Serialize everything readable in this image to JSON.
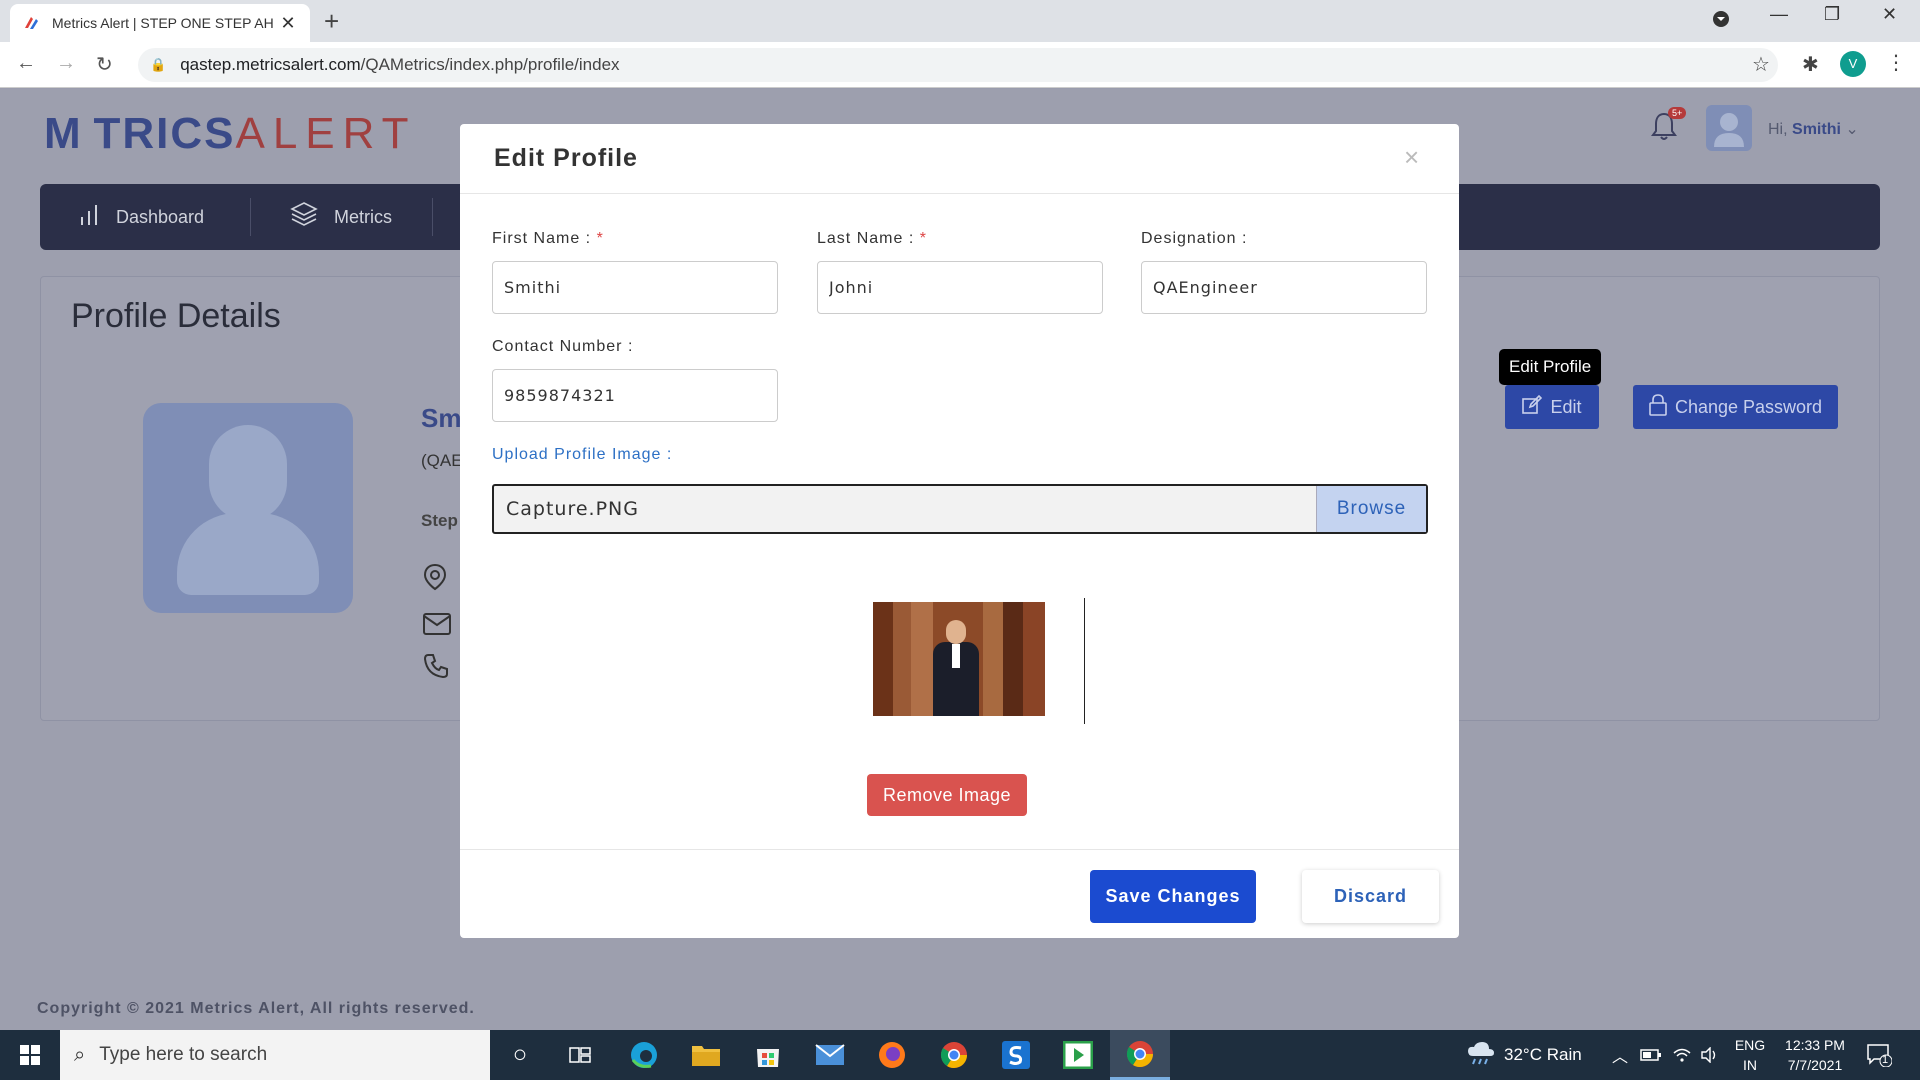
{
  "browser": {
    "tab_title": "Metrics Alert | STEP ONE STEP AH",
    "url_domain": "qastep.metricsalert.com",
    "url_path": "/QAMetrics/index.php/profile/index",
    "profile_initial": "V"
  },
  "header": {
    "logo_metrics": "M TRICS",
    "logo_alert": "ALERT",
    "notif_badge": "5+",
    "greeting": "Hi,",
    "username": "Smithi"
  },
  "nav": {
    "items": [
      {
        "label": "Dashboard"
      },
      {
        "label": "Metrics"
      }
    ]
  },
  "profile": {
    "title": "Profile Details",
    "name_partial": "Sm",
    "role_partial": "(QAE",
    "company_partial": "Step",
    "tooltip": "Edit Profile",
    "edit_label": "Edit",
    "change_password_label": "Change Password"
  },
  "modal": {
    "title": "Edit Profile",
    "close_glyph": "×",
    "first_name_label": "First Name :",
    "last_name_label": "Last Name :",
    "designation_label": "Designation :",
    "contact_label": "Contact Number :",
    "required_mark": "*",
    "first_name_value": "Smithi",
    "last_name_value": "Johni",
    "designation_value": "QAEngineer",
    "contact_value": "9859874321",
    "upload_label": "Upload Profile Image :",
    "file_name": "Capture.PNG",
    "browse_label": "Browse",
    "remove_image_label": "Remove Image",
    "save_label": "Save Changes",
    "discard_label": "Discard"
  },
  "footer": {
    "copyright": "Copyright © 2021 Metrics Alert, All rights reserved."
  },
  "taskbar": {
    "search_placeholder": "Type here to search",
    "weather": "32°C  Rain",
    "lang_top": "ENG",
    "lang_bottom": "IN",
    "time": "12:33 PM",
    "date": "7/7/2021",
    "notif_count": "1"
  }
}
